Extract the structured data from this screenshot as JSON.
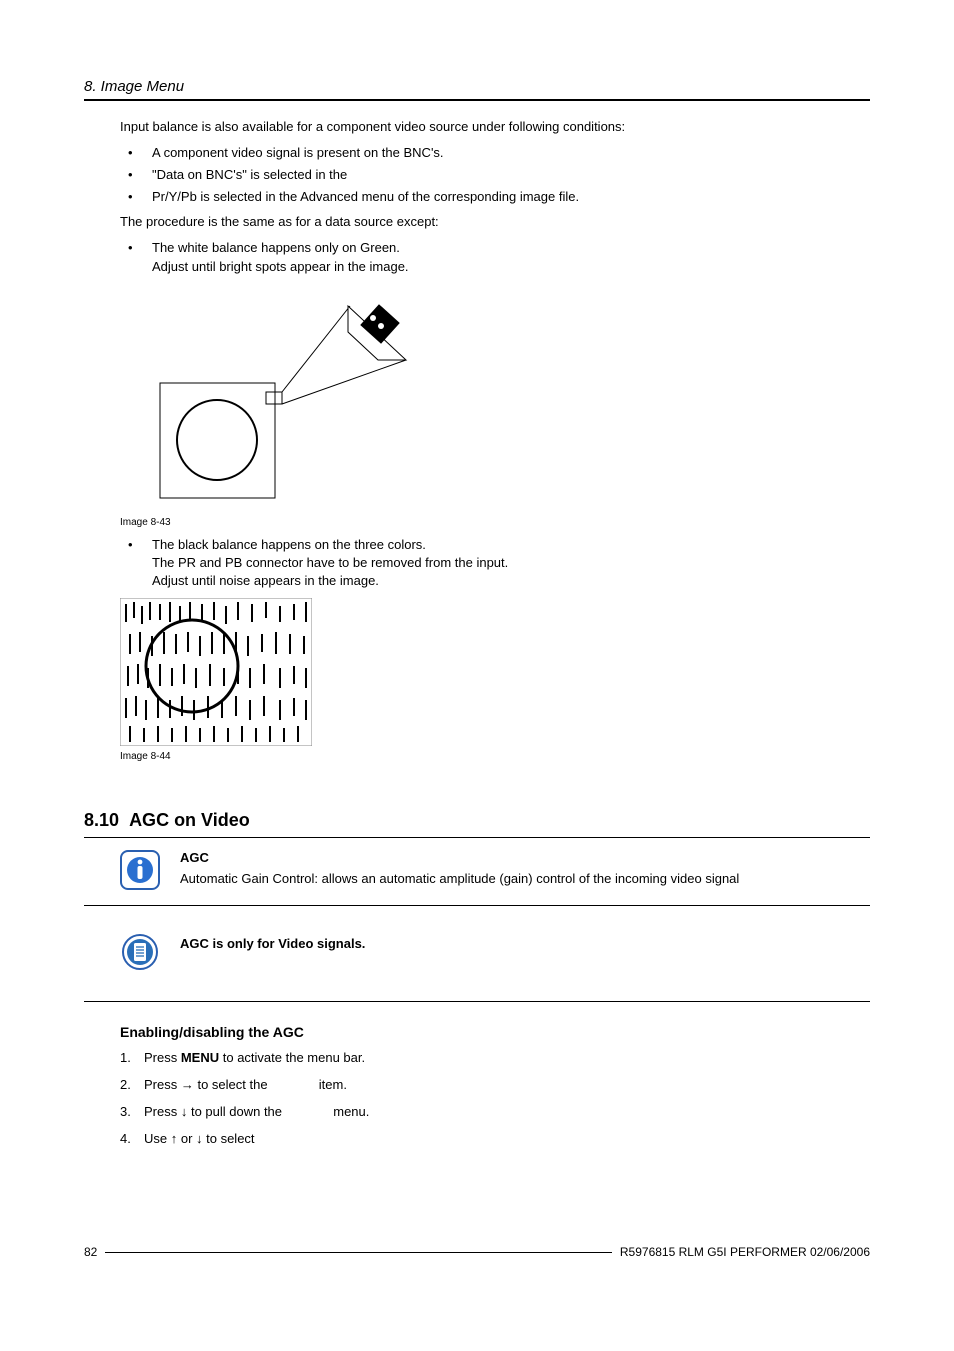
{
  "header": {
    "title": "8. Image Menu"
  },
  "intro": {
    "p1": "Input balance is also available for a component video source under following conditions:",
    "bullets1": [
      "A component video signal is present on the BNC's.",
      "\"Data on BNC's\" is selected in the",
      "Pr/Y/Pb is selected in the Advanced menu of the corresponding image file."
    ],
    "p2": "The procedure is the same as for a data source except:",
    "bullets2_item1_l1": "The white balance happens only on Green.",
    "bullets2_item1_l2": "Adjust until bright spots appear in the image."
  },
  "fig1": {
    "caption": "Image 8-43"
  },
  "after_fig1": {
    "b1_l1": "The black balance happens on the three colors.",
    "b1_l2": "The PR and PB connector have to be removed from the input.",
    "b1_l3": "Adjust until noise appears in the image."
  },
  "fig2": {
    "caption": "Image 8-44"
  },
  "section": {
    "num": "8.10",
    "title": "AGC on Video"
  },
  "info": {
    "title": "AGC",
    "desc": "Automatic Gain Control: allows an automatic amplitude (gain) control of the incoming video signal"
  },
  "note": {
    "text": "AGC is only for Video signals."
  },
  "subheading": "Enabling/disabling the AGC",
  "steps": {
    "s1a": "Press ",
    "s1b": "MENU",
    "s1c": " to activate the menu bar.",
    "s2a": "Press → to select the ",
    "s2b": " item.",
    "s3a": "Press ↓ to pull down the ",
    "s3b": " menu.",
    "s4": "Use ↑ or ↓ to select"
  },
  "footer": {
    "page": "82",
    "doc": "R5976815  RLM G5I PERFORMER  02/06/2006"
  }
}
